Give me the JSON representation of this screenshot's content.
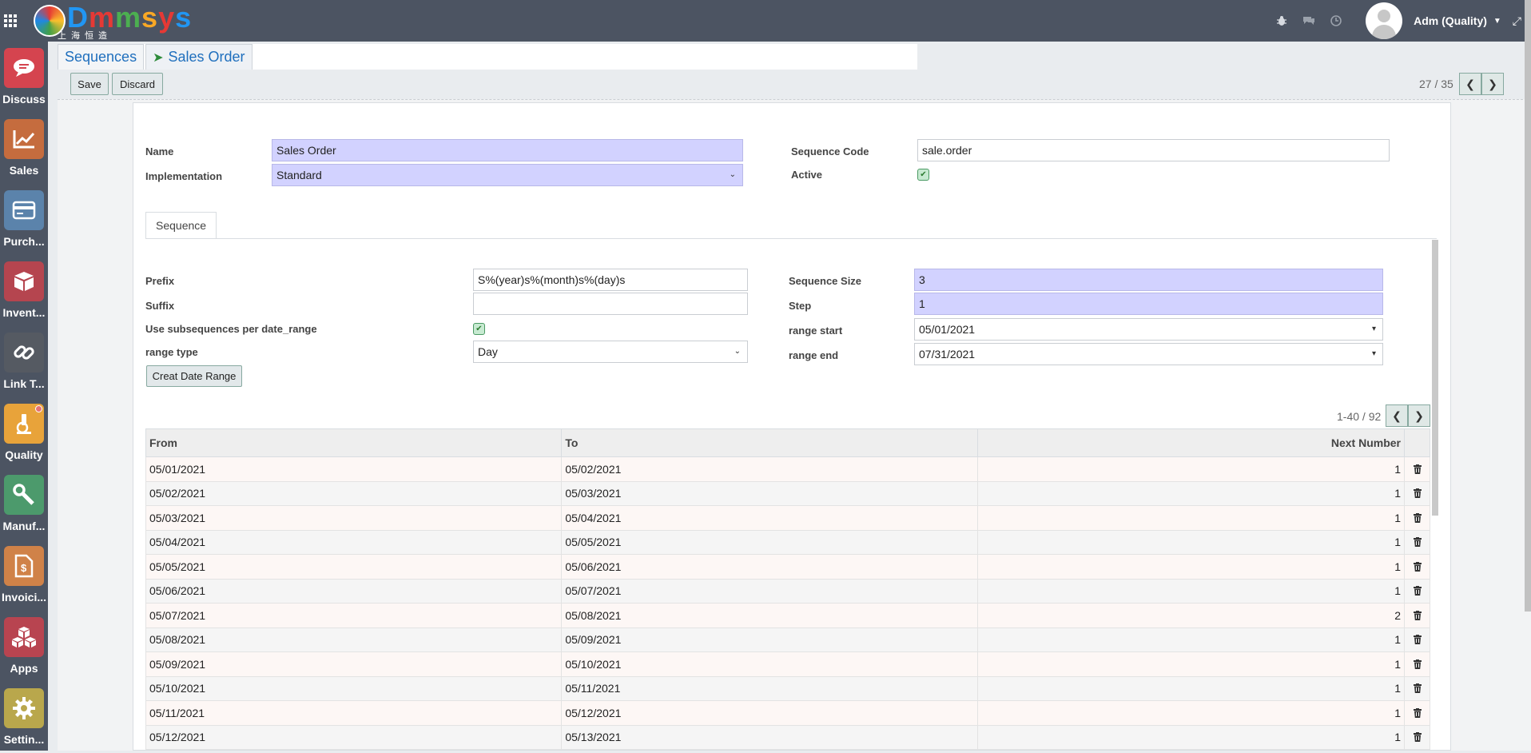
{
  "topbar": {
    "logo_text": "Dmmsys",
    "logo_sub": "上海恒造",
    "user_name": "Adm (Quality)",
    "icons": [
      "bug-icon",
      "chat-icon",
      "clock-icon",
      "expand-icon"
    ]
  },
  "sidebar": {
    "items": [
      {
        "label": "Discuss",
        "icon": "chat-bubble-icon",
        "color": "#d5444f"
      },
      {
        "label": "Sales",
        "icon": "chart-line-icon",
        "color": "#c56c3e"
      },
      {
        "label": "Purch...",
        "icon": "credit-card-icon",
        "color": "#5b83ab"
      },
      {
        "label": "Invent...",
        "icon": "box-icon",
        "color": "#b5454f"
      },
      {
        "label": "Link T...",
        "icon": "link-icon",
        "color": "#555a62"
      },
      {
        "label": "Quality",
        "icon": "microscope-icon",
        "color": "#e8a33a"
      },
      {
        "label": "Manuf...",
        "icon": "wrench-icon",
        "color": "#4c9a6c"
      },
      {
        "label": "Invoici...",
        "icon": "invoice-icon",
        "color": "#d08248"
      },
      {
        "label": "Apps",
        "icon": "cubes-icon",
        "color": "#b84450"
      },
      {
        "label": "Settin...",
        "icon": "gear-icon",
        "color": "#b9a74c"
      }
    ]
  },
  "breadcrumb": {
    "parent": "Sequences",
    "current": "Sales Order"
  },
  "toolbar": {
    "save_label": "Save",
    "discard_label": "Discard",
    "pager": "27 / 35"
  },
  "form": {
    "name_label": "Name",
    "name_value": "Sales Order",
    "implementation_label": "Implementation",
    "implementation_value": "Standard",
    "sequence_code_label": "Sequence Code",
    "sequence_code_value": "sale.order",
    "active_label": "Active",
    "tab_label": "Sequence",
    "prefix_label": "Prefix",
    "prefix_value": "S%(year)s%(month)s%(day)s",
    "suffix_label": "Suffix",
    "suffix_value": "",
    "use_subseq_label": "Use subsequences per date_range",
    "range_type_label": "range type",
    "range_type_value": "Day",
    "create_range_label": "Creat Date Range",
    "seq_size_label": "Sequence Size",
    "seq_size_value": "3",
    "step_label": "Step",
    "step_value": "1",
    "range_start_label": "range start",
    "range_start_value": "05/01/2021",
    "range_end_label": "range end",
    "range_end_value": "07/31/2021"
  },
  "table": {
    "pager": "1-40 / 92",
    "headers": [
      "From",
      "To",
      "Next Number"
    ],
    "rows": [
      [
        "05/01/2021",
        "05/02/2021",
        "1"
      ],
      [
        "05/02/2021",
        "05/03/2021",
        "1"
      ],
      [
        "05/03/2021",
        "05/04/2021",
        "1"
      ],
      [
        "05/04/2021",
        "05/05/2021",
        "1"
      ],
      [
        "05/05/2021",
        "05/06/2021",
        "1"
      ],
      [
        "05/06/2021",
        "05/07/2021",
        "1"
      ],
      [
        "05/07/2021",
        "05/08/2021",
        "2"
      ],
      [
        "05/08/2021",
        "05/09/2021",
        "1"
      ],
      [
        "05/09/2021",
        "05/10/2021",
        "1"
      ],
      [
        "05/10/2021",
        "05/11/2021",
        "1"
      ],
      [
        "05/11/2021",
        "05/12/2021",
        "1"
      ],
      [
        "05/12/2021",
        "05/13/2021",
        "1"
      ]
    ]
  },
  "colors": {
    "topbar": "#4c5462",
    "required_field": "#d2d2ff",
    "link": "#1f6fbd"
  }
}
